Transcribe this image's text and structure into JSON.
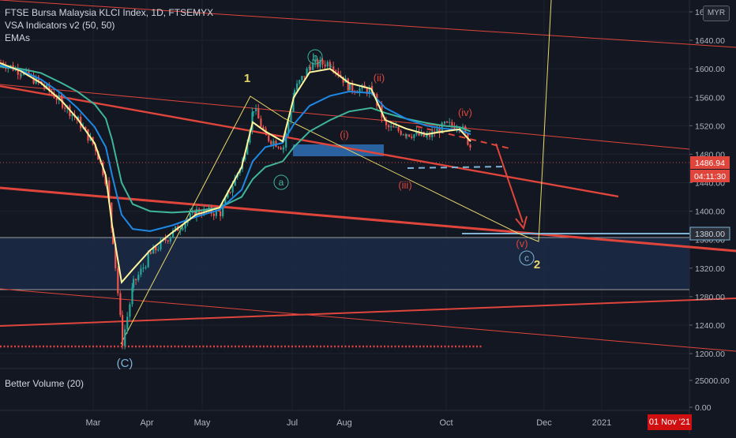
{
  "legend": {
    "symbol": "FTSE Bursa Malaysia KLCI Index, 1D, FTSEMYX",
    "indicator1": "VSA Indicators v2 (50, 50)",
    "indicator2": "EMAs"
  },
  "volume_legend": "Better Volume (20)",
  "currency_button": "MYR",
  "crosshair_date": "01 Nov '21",
  "chart_data": {
    "type": "candlestick",
    "title": "FTSE Bursa Malaysia KLCI Index, 1D, FTSEMYX",
    "ylim": [
      1190,
      1705
    ],
    "y_ticks": [
      1200,
      1240,
      1280,
      1320,
      1360,
      1400,
      1440,
      1480,
      1520,
      1560,
      1600,
      1640,
      1680
    ],
    "x_ticks": [
      "Mar",
      "Apr",
      "May",
      "Jul",
      "Aug",
      "Oct",
      "Dec",
      "2021"
    ],
    "volume_ticks": [
      "25000.00",
      "0.00"
    ],
    "last_price": "1486.94",
    "countdown": "04:11:30",
    "marked_level": "1380.00",
    "wave_labels": [
      "1",
      "2",
      "(C)",
      "a",
      "b",
      "c",
      "(i)",
      "(ii)",
      "(iii)",
      "(iv)",
      "(v)"
    ],
    "price_path": [
      [
        "2020-01-02",
        1609
      ],
      [
        "2020-01-15",
        1596
      ],
      [
        "2020-01-28",
        1578
      ],
      [
        "2020-02-10",
        1552
      ],
      [
        "2020-02-20",
        1527
      ],
      [
        "2020-03-02",
        1488
      ],
      [
        "2020-03-09",
        1440
      ],
      [
        "2020-03-13",
        1360
      ],
      [
        "2020-03-19",
        1216
      ],
      [
        "2020-03-26",
        1298
      ],
      [
        "2020-04-06",
        1340
      ],
      [
        "2020-04-20",
        1370
      ],
      [
        "2020-05-05",
        1400
      ],
      [
        "2020-05-20",
        1398
      ],
      [
        "2020-06-03",
        1470
      ],
      [
        "2020-06-10",
        1545
      ],
      [
        "2020-06-18",
        1504
      ],
      [
        "2020-06-29",
        1490
      ],
      [
        "2020-07-06",
        1570
      ],
      [
        "2020-07-16",
        1605
      ],
      [
        "2020-07-29",
        1609
      ],
      [
        "2020-08-10",
        1573
      ],
      [
        "2020-08-24",
        1569
      ],
      [
        "2020-09-02",
        1518
      ],
      [
        "2020-09-15",
        1510
      ],
      [
        "2020-09-28",
        1504
      ],
      [
        "2020-10-09",
        1520
      ],
      [
        "2020-10-19",
        1521
      ],
      [
        "2020-10-26",
        1487
      ]
    ],
    "ema_fast": [
      1608,
      1597,
      1580,
      1555,
      1530,
      1495,
      1450,
      1380,
      1300,
      1318,
      1345,
      1370,
      1395,
      1405,
      1462,
      1525,
      1512,
      1498,
      1560,
      1595,
      1600,
      1580,
      1572,
      1528,
      1516,
      1508,
      1512,
      1515,
      1498
    ],
    "ema_slow": [
      1605,
      1598,
      1585,
      1565,
      1545,
      1518,
      1490,
      1450,
      1395,
      1375,
      1372,
      1380,
      1392,
      1402,
      1430,
      1470,
      1490,
      1496,
      1522,
      1548,
      1562,
      1568,
      1566,
      1545,
      1530,
      1520,
      1516,
      1514,
      1508
    ],
    "ema_long": [
      1603,
      1600,
      1594,
      1580,
      1568,
      1550,
      1530,
      1500,
      1440,
      1410,
      1400,
      1398,
      1400,
      1405,
      1420,
      1445,
      1462,
      1470,
      1490,
      1512,
      1528,
      1540,
      1545,
      1538,
      1530,
      1524,
      1520,
      1518,
      1512
    ]
  }
}
